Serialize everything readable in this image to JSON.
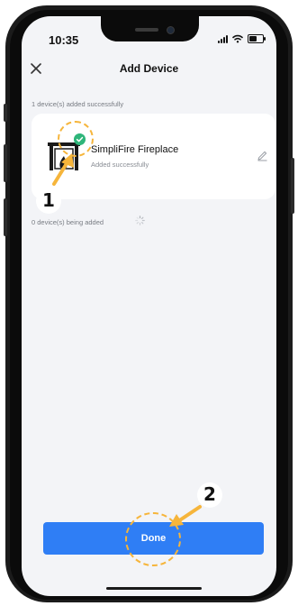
{
  "status_bar": {
    "time": "10:35"
  },
  "header": {
    "title": "Add Device",
    "close_icon": "close-icon"
  },
  "added_section": {
    "label": "1 device(s) added successfully"
  },
  "device": {
    "name": "SimpliFire Fireplace",
    "status": "Added successfully",
    "icon": "fireplace-icon",
    "badge_icon": "check-icon",
    "edit_icon": "pencil-icon"
  },
  "adding_section": {
    "label": "0 device(s) being added",
    "spinner_icon": "loading-spinner-icon"
  },
  "footer": {
    "done_label": "Done"
  },
  "annotations": {
    "step1": "1",
    "step2": "2"
  },
  "colors": {
    "accent": "#2f7ef5",
    "success": "#2fb57a",
    "annotation": "#f6b53b",
    "background": "#f3f4f7"
  }
}
